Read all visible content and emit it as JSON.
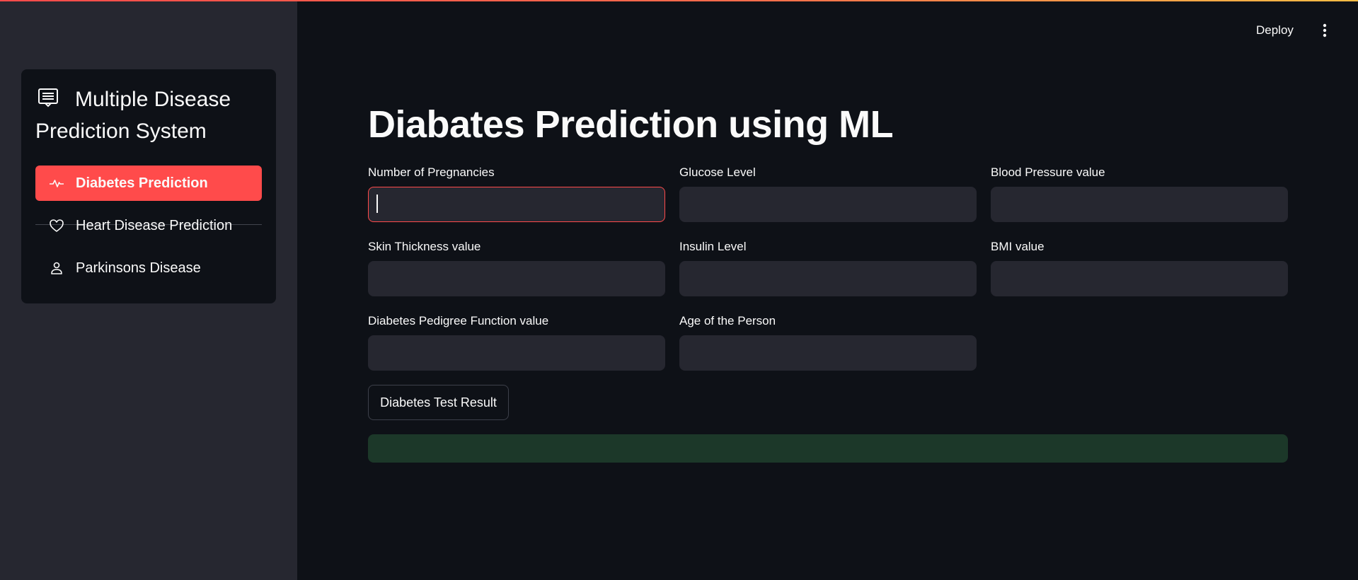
{
  "app": {
    "deploy_label": "Deploy"
  },
  "sidebar": {
    "menu_title": "Multiple Disease Prediction System",
    "items": [
      {
        "label": "Diabetes Prediction",
        "icon": "activity-icon",
        "active": true
      },
      {
        "label": "Heart Disease Prediction",
        "icon": "heart-icon",
        "active": false
      },
      {
        "label": "Parkinsons Disease",
        "icon": "person-icon",
        "active": false
      }
    ]
  },
  "main": {
    "title": "Diabates Prediction using ML",
    "fields": [
      {
        "label": "Number of Pregnancies",
        "value": ""
      },
      {
        "label": "Glucose Level",
        "value": ""
      },
      {
        "label": "Blood Pressure value",
        "value": ""
      },
      {
        "label": "Skin Thickness value",
        "value": ""
      },
      {
        "label": "Insulin Level",
        "value": ""
      },
      {
        "label": "BMI value",
        "value": ""
      },
      {
        "label": "Diabetes Pedigree Function value",
        "value": ""
      },
      {
        "label": "Age of the Person",
        "value": ""
      }
    ],
    "submit_label": "Diabetes Test Result",
    "result_text": ""
  },
  "colors": {
    "accent": "#ff4b4b",
    "background": "#0e1117",
    "sidebar": "#262730",
    "success_box": "#1c3829"
  }
}
